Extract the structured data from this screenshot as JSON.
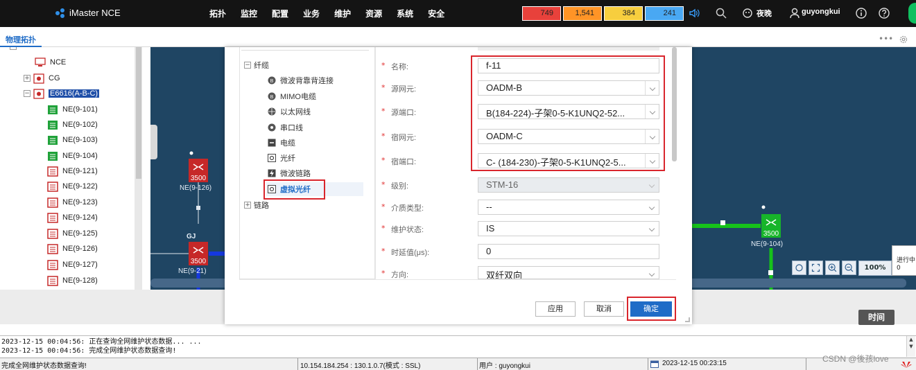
{
  "app": {
    "title": "iMaster NCE",
    "nav": [
      "拓扑",
      "监控",
      "配置",
      "业务",
      "维护",
      "资源",
      "系统",
      "安全"
    ],
    "alarms": {
      "critical": "749",
      "major": "1,541",
      "minor": "384",
      "warning": "241"
    },
    "theme_label": "夜晚",
    "username": "guyongkui",
    "colors": {
      "critical": "#e8413b",
      "major": "#ff9426",
      "minor": "#f7ce3e",
      "warning": "#49a8f3",
      "accent": "#1f6cc7",
      "highlight": "#d9252c"
    }
  },
  "tabs": {
    "active": "物理拓扑"
  },
  "tree": {
    "root": "NCE",
    "group_cg": "CG",
    "selected_group": "E6616(A-B-C)",
    "items": [
      "NE(9-101)",
      "NE(9-102)",
      "NE(9-103)",
      "NE(9-104)",
      "NE(9-121)",
      "NE(9-122)",
      "NE(9-123)",
      "NE(9-124)",
      "NE(9-125)",
      "NE(9-126)",
      "NE(9-127)",
      "NE(9-128)"
    ]
  },
  "canvas": {
    "nodes": [
      {
        "label": "NE(9-126)",
        "model": "3500"
      },
      {
        "label": "NE(9-21)",
        "model": "3500",
        "tag": "GJ"
      },
      {
        "label": "NE(9-104)",
        "model": "3500"
      }
    ],
    "zoom_level": "100%",
    "progress_tip": "进行中\n0",
    "time_button": "时间"
  },
  "dialog": {
    "types": {
      "fiber_group": "纤缆",
      "items": [
        "微波背靠背连接",
        "MIMO电缆",
        "以太网线",
        "串口线",
        "电缆",
        "光纤",
        "微波链路",
        "虚拟光纤"
      ],
      "selected": "虚拟光纤",
      "link_group": "链路"
    },
    "form": {
      "name": {
        "label": "名称:",
        "value": "f-11"
      },
      "source_ne": {
        "label": "源网元:",
        "value": "OADM-B"
      },
      "source_port": {
        "label": "源端口:",
        "value": "B(184-224)-子架0-5-K1UNQ2-52..."
      },
      "sink_ne": {
        "label": "宿网元:",
        "value": "OADM-C"
      },
      "sink_port": {
        "label": "宿端口:",
        "value": "C- (184-230)-子架0-5-K1UNQ2-5..."
      },
      "level": {
        "label": "级别:",
        "value": "STM-16"
      },
      "medium": {
        "label": "介质类型:",
        "value": "--"
      },
      "maintenance": {
        "label": "维护状态:",
        "value": "IS"
      },
      "delay": {
        "label": "时延值(μs):",
        "value": "0"
      },
      "direction": {
        "label": "方向:",
        "value": "双纤双向"
      }
    },
    "buttons": {
      "apply": "应用",
      "cancel": "取消",
      "ok": "确定"
    }
  },
  "log": [
    "2023-12-15 00:04:56: 正在查询全网维护状态数据... ...",
    "2023-12-15 00:04:56: 完成全网维护状态数据查询!"
  ],
  "status": {
    "message": "完成全网维护状态数据查询!",
    "server": "10.154.184.254 : 130.1.0.7(模式 : SSL)",
    "user": "用户 : guyongkui",
    "datetime": "2023-12-15 00:23:15"
  },
  "watermark": "CSDN @後孩love"
}
